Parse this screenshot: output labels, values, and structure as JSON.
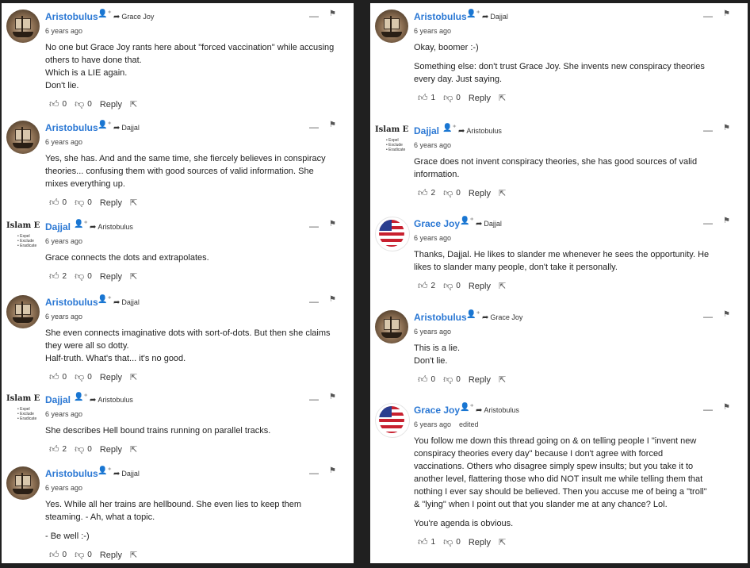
{
  "left": [
    {
      "author": "Aristobulus",
      "avatar": "ship",
      "reply_to": "Grace Joy",
      "time": "6 years ago",
      "edited": "",
      "paragraphs": [
        [
          "No one but Grace Joy rants here about \"forced vaccination\" while accusing",
          "others to have done that.",
          "Which is a LIE again.",
          "Don't lie."
        ]
      ],
      "likes": "0",
      "dislikes": "0",
      "reply": "Reply"
    },
    {
      "author": "Aristobulus",
      "avatar": "ship",
      "reply_to": "Dajjal",
      "time": "6 years ago",
      "edited": "",
      "paragraphs": [
        [
          "Yes, she has. And and the same time, she fiercely believes in conspiracy",
          "theories... confusing them with good sources of valid information. She",
          "mixes everything up."
        ]
      ],
      "likes": "0",
      "dislikes": "0",
      "reply": "Reply"
    },
    {
      "author": "Dajjal",
      "avatar": "islam",
      "reply_to": "Aristobulus",
      "time": "6 years ago",
      "edited": "",
      "paragraphs": [
        [
          "Grace connects the dots and extrapolates."
        ]
      ],
      "likes": "2",
      "dislikes": "0",
      "reply": "Reply"
    },
    {
      "author": "Aristobulus",
      "avatar": "ship",
      "reply_to": "Dajjal",
      "time": "6 years ago",
      "edited": "",
      "paragraphs": [
        [
          "She even connects imaginative dots with sort-of-dots. But then she claims",
          "they were all so dotty.",
          "Half-truth. What's that... it's no good."
        ]
      ],
      "likes": "0",
      "dislikes": "0",
      "reply": "Reply"
    },
    {
      "author": "Dajjal",
      "avatar": "islam",
      "reply_to": "Aristobulus",
      "time": "6 years ago",
      "edited": "",
      "paragraphs": [
        [
          "She describes Hell bound trains running on parallel tracks."
        ]
      ],
      "likes": "2",
      "dislikes": "0",
      "reply": "Reply"
    },
    {
      "author": "Aristobulus",
      "avatar": "ship",
      "reply_to": "Dajjal",
      "time": "6 years ago",
      "edited": "",
      "paragraphs": [
        [
          "Yes. While all her trains are hellbound. She even lies to keep them",
          "steaming. - Ah, what a topic."
        ],
        [
          "- Be well :-)"
        ]
      ],
      "likes": "0",
      "dislikes": "0",
      "reply": "Reply"
    }
  ],
  "right": [
    {
      "author": "Aristobulus",
      "avatar": "ship",
      "reply_to": "Dajjal",
      "time": "6 years ago",
      "edited": "",
      "paragraphs": [
        [
          "Okay, boomer :-)"
        ],
        [
          "Something else: don't trust Grace Joy. She invents new conspiracy theories",
          "every day. Just saying."
        ]
      ],
      "likes": "1",
      "dislikes": "0",
      "reply": "Reply"
    },
    {
      "author": "Dajjal",
      "avatar": "islam",
      "reply_to": "Aristobulus",
      "time": "6 years ago",
      "edited": "",
      "paragraphs": [
        [
          "Grace does not invent conspiracy theories, she has good sources of valid",
          "information."
        ]
      ],
      "likes": "2",
      "dislikes": "0",
      "reply": "Reply"
    },
    {
      "author": "Grace Joy",
      "avatar": "flag",
      "reply_to": "Dajjal",
      "time": "6 years ago",
      "edited": "",
      "paragraphs": [
        [
          "Thanks, Dajjal. He likes to slander me whenever he sees the opportunity. He",
          "likes to slander many people, don't take it personally."
        ]
      ],
      "likes": "2",
      "dislikes": "0",
      "reply": "Reply"
    },
    {
      "author": "Aristobulus",
      "avatar": "ship",
      "reply_to": "Grace Joy",
      "time": "6 years ago",
      "edited": "",
      "paragraphs": [
        [
          "This is a lie.",
          "Don't lie."
        ]
      ],
      "likes": "0",
      "dislikes": "0",
      "reply": "Reply"
    },
    {
      "author": "Grace Joy",
      "avatar": "flag",
      "reply_to": "Aristobulus",
      "time": "6 years ago",
      "edited": "edited",
      "paragraphs": [
        [
          "You follow me down this thread going on & on telling people I \"invent new",
          "conspiracy theories every day\" because I don't agree with forced",
          "vaccinations. Others who disagree simply spew insults; but you take it to",
          "another level, flattering those who did NOT insult me while telling them that",
          "nothing I ever say should be believed. Then you accuse me of being a \"troll\"",
          "& \"lying\" when I point out that you slander me at any chance? Lol."
        ],
        [
          "You're agenda is obvious."
        ]
      ],
      "likes": "1",
      "dislikes": "0",
      "reply": "Reply"
    }
  ],
  "islam_avatar": {
    "title": "Islam E",
    "lines": [
      "• Expel",
      "• Exclude",
      "• Eradicate"
    ]
  },
  "icons": {
    "follow": "follow-plus-icon",
    "reply_arrow": "reply-arrow-icon",
    "minimize": "collapse-dash-icon",
    "flag": "report-flag-icon",
    "like": "thumbs-up-icon",
    "dislike": "thumbs-down-icon",
    "share": "share-icon"
  },
  "colors": {
    "author": "#2b78d4",
    "background": "#202020",
    "panel": "#ffffff"
  }
}
